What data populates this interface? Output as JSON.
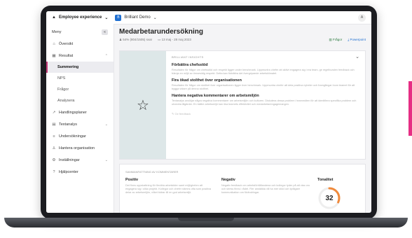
{
  "topbar": {
    "app_name": "Employee experience",
    "workspace": "Brilliant Demo",
    "workspace_initial": "B",
    "user_initial": "A"
  },
  "sidebar": {
    "menu_label": "Meny",
    "toggle_label": "«",
    "items": [
      {
        "label": "Översikt",
        "icon": "home-icon"
      },
      {
        "label": "Resultat",
        "icon": "chart-icon"
      },
      {
        "label": "Summering",
        "active": true
      },
      {
        "label": "NPS"
      },
      {
        "label": "Frågor"
      },
      {
        "label": "Analysera"
      },
      {
        "label": "Handlingsplaner",
        "icon": "checklist-icon"
      },
      {
        "label": "Textanalys",
        "icon": "text-icon"
      },
      {
        "label": "Undersökningar",
        "icon": "survey-icon"
      },
      {
        "label": "Hantera organisation",
        "icon": "org-icon"
      },
      {
        "label": "Inställningar",
        "icon": "gear-icon"
      },
      {
        "label": "Hjälpcenter",
        "icon": "help-icon"
      }
    ]
  },
  "main": {
    "title": "Medarbetarundersökning",
    "response_rate": "54% (804/1505) svar",
    "date_range": "13 maj - 28 maj 2023",
    "questions_link": "Frågor",
    "powerpoint_link": "Powerpoint"
  },
  "insights": {
    "label": "BRILLIANT INSIGHTS",
    "items": [
      {
        "title": "Förbättra chefsstöd",
        "text": "Resultaten för frågor om chefsstöd och respekt ligger under benchmark. Uppmuntra chefer att aktivt engagera sig i era team, ge regelbunden feedback och främja en miljö av ömsesidig respekt. Detta kan förbättra det övergripande arbetsklimatet."
      },
      {
        "title": "Fira ökad stolthet över organisationen",
        "text": "Resultaten för frågor om stolthet över organisationen ligger över benchmark. Uppmuntra chefer att dela positiva nyheter och framgångar inom teamet för att bygga vidare på denna stolthet."
      },
      {
        "title": "Hantera negativa kommentarer om arbetsmiljön",
        "text": "Textanalys avslöjar några negativa kommentarer om arbetsmiljön och kulturen. Diskutera dessa problem i teammöten för att identifiera specifika problem och utveckla åtgärder. En bättre arbetsmiljö kan öka teamets effektivitet och medarbetarengagemangen."
      }
    ],
    "feedback": "Ge feedback"
  },
  "summary": {
    "label": "SAMMANFATTNING AV KOMMENTARER",
    "positive_title": "Positiv",
    "positive_text": "Det finns uppskattning för flexibla arbetstider samt möjligheten att engagera sig i olika projekt. Kollegor och chefer nämns ofta som positiva delar av arbetsmiljön, vilket bidrar till en god arbetsmiljö.",
    "negative_title": "Negativ",
    "negative_text": "Negativ feedback om arbetsförhållandena och kollegor tyder på att viss oro och stress finns i rådet. Fler anställda vill ha mer stöd och tydligare kommunikation om förändringar.",
    "tone_title": "Tonalitet",
    "tone_value": 32,
    "tone_color": "#f08a3c"
  }
}
